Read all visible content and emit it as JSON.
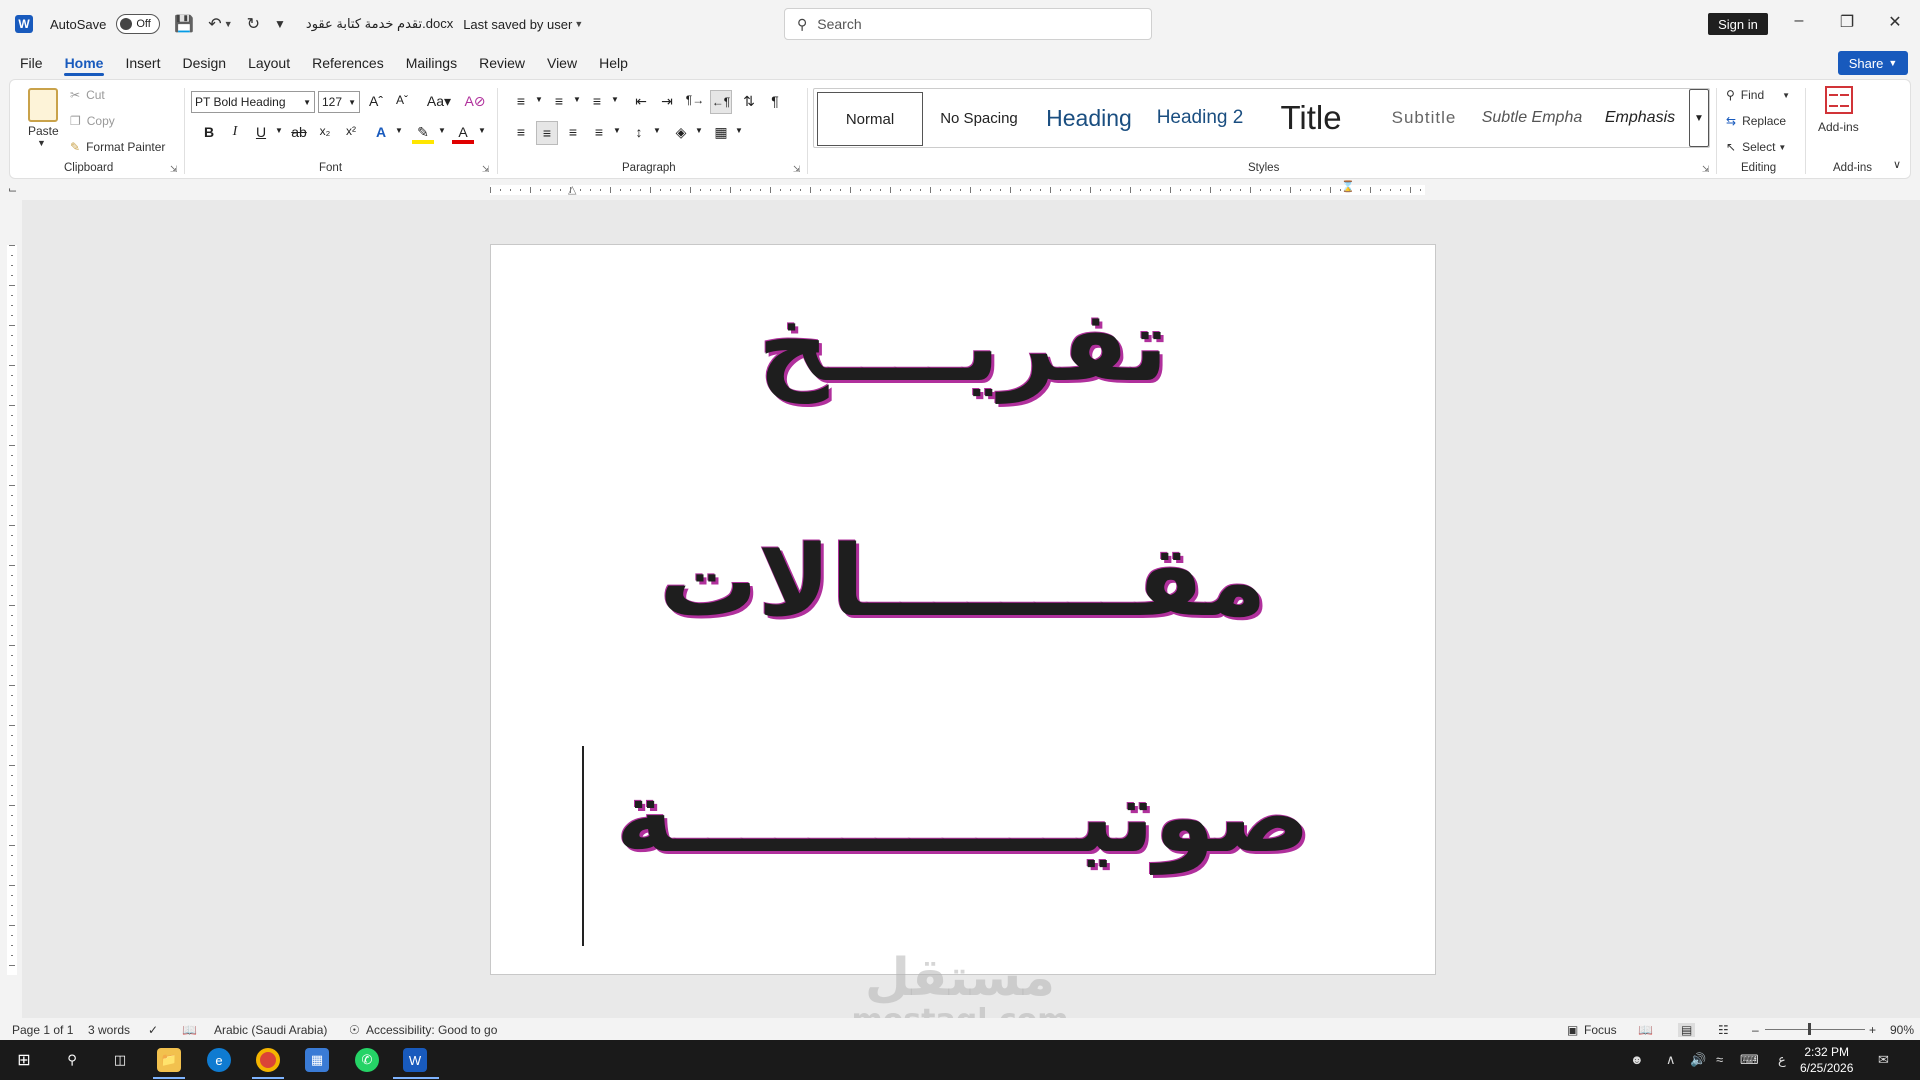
{
  "titlebar": {
    "autosave_label": "AutoSave",
    "autosave_state": "Off",
    "doc_title": "تقدم خدمة كتابة عقود.docx",
    "saved_status": "Last saved by user",
    "search_placeholder": "Search",
    "sign_in": "Sign in"
  },
  "tabs": [
    "File",
    "Home",
    "Insert",
    "Design",
    "Layout",
    "References",
    "Mailings",
    "Review",
    "View",
    "Help"
  ],
  "share_label": "Share",
  "ribbon": {
    "clipboard": {
      "label": "Clipboard",
      "paste": "Paste",
      "cut": "Cut",
      "copy": "Copy",
      "format_painter": "Format Painter"
    },
    "font": {
      "label": "Font",
      "font_name": "PT Bold Heading",
      "font_size": "127"
    },
    "paragraph": {
      "label": "Paragraph"
    },
    "styles": {
      "label": "Styles",
      "items": [
        "Normal",
        "No Spacing",
        "Heading",
        "Heading 2",
        "Title",
        "Subtitle",
        "Subtle Empha",
        "Emphasis"
      ]
    },
    "editing": {
      "label": "Editing",
      "find": "Find",
      "replace": "Replace",
      "select": "Select"
    },
    "addins": {
      "label": "Add-ins",
      "button": "Add-ins"
    }
  },
  "document": {
    "lines": [
      "تفريــــخ",
      "مقــــــــالات",
      "صوتيــــــــــــة"
    ]
  },
  "watermark": {
    "arabic": "مستقل",
    "latin": "mostaql.com"
  },
  "statusbar": {
    "page": "Page 1 of 1",
    "words": "3 words",
    "language": "Arabic (Saudi Arabia)",
    "accessibility": "Accessibility: Good to go",
    "focus": "Focus",
    "zoom": "90%"
  },
  "taskbar": {
    "time": "2:32 PM",
    "date": "6/25/2026",
    "input_lang": "ع"
  },
  "colors": {
    "accent": "#185abd",
    "text_shadow": "#b0309c"
  }
}
